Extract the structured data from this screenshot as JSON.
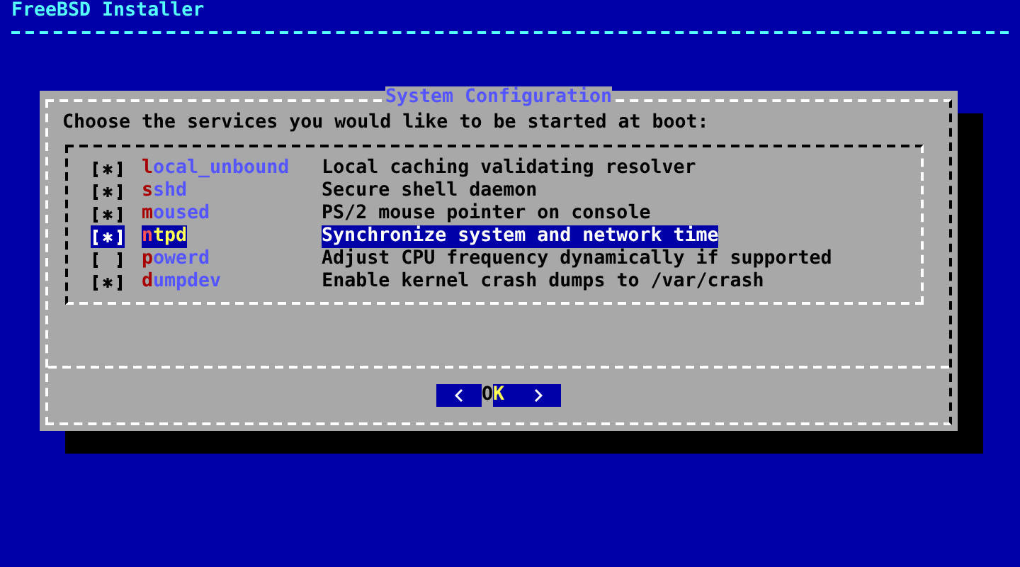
{
  "screen": {
    "title": "FreeBSD Installer"
  },
  "dialog": {
    "title": "System Configuration",
    "prompt": "Choose the services you would like to be started at boot:",
    "services": [
      {
        "name": "local_unbound",
        "description": "Local caching validating resolver",
        "checked": true,
        "selected": false
      },
      {
        "name": "sshd",
        "description": "Secure shell daemon",
        "checked": true,
        "selected": false
      },
      {
        "name": "moused",
        "description": "PS/2 mouse pointer on console",
        "checked": true,
        "selected": false
      },
      {
        "name": "ntpd",
        "description": "Synchronize system and network time",
        "checked": true,
        "selected": true
      },
      {
        "name": "powerd",
        "description": "Adjust CPU frequency dynamically if supported",
        "checked": false,
        "selected": false
      },
      {
        "name": "dumpdev",
        "description": "Enable kernel crash dumps to /var/crash",
        "checked": true,
        "selected": false
      }
    ],
    "button": {
      "label": "OK",
      "focused": true
    }
  }
}
